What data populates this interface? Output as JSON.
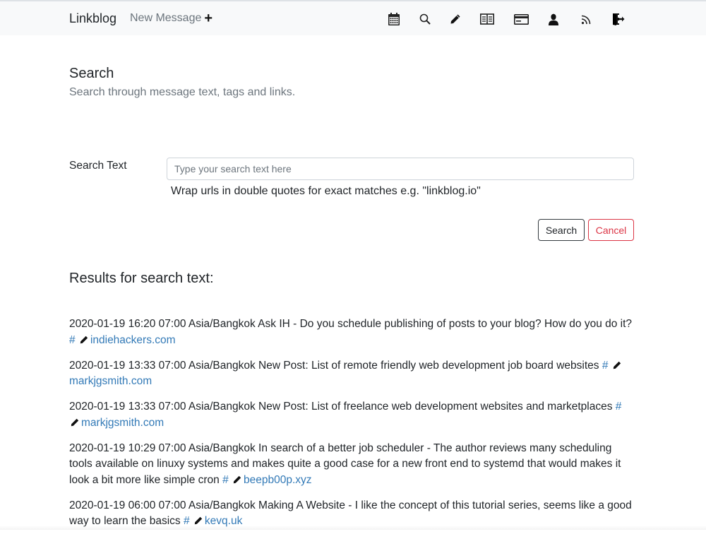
{
  "navbar": {
    "brand": "Linkblog",
    "new_message_label": "New Message",
    "new_message_icon": "plus-icon",
    "icons": [
      {
        "name": "calendar-icon",
        "title": "Calendar"
      },
      {
        "name": "search-icon",
        "title": "Search"
      },
      {
        "name": "pencil-icon",
        "title": "Edit"
      },
      {
        "name": "book-icon",
        "title": "Read"
      },
      {
        "name": "credit-card-icon",
        "title": "Billing"
      },
      {
        "name": "user-icon",
        "title": "Account"
      },
      {
        "name": "rss-icon",
        "title": "RSS"
      },
      {
        "name": "logout-icon",
        "title": "Log out"
      }
    ]
  },
  "page": {
    "title": "Search",
    "subtitle": "Search through message text, tags and links."
  },
  "form": {
    "label": "Search Text",
    "value": "",
    "placeholder": "Type your search text here",
    "help": "Wrap urls in double quotes for exact matches e.g. \"linkblog.io\"",
    "search_button": "Search",
    "cancel_button": "Cancel"
  },
  "results": {
    "title": "Results for search text:",
    "hash": "#",
    "items": [
      {
        "timestamp": "2020-01-19 16:20 07:00 Asia/Bangkok",
        "text": "Ask IH - Do you schedule publishing of posts to your blog? How do you do it?",
        "domain": "indiehackers.com"
      },
      {
        "timestamp": "2020-01-19 13:33 07:00 Asia/Bangkok",
        "text": "New Post: List of remote friendly web development job board websites",
        "domain": "markjgsmith.com"
      },
      {
        "timestamp": "2020-01-19 13:33 07:00 Asia/Bangkok",
        "text": "New Post: List of freelance web development websites and marketplaces",
        "domain": "markjgsmith.com"
      },
      {
        "timestamp": "2020-01-19 10:29 07:00 Asia/Bangkok",
        "text": "In search of a better job scheduler - The author reviews many scheduling tools available on linuxy systems and makes quite a good case for a new front end to systemd that would makes it look a bit more like simple cron",
        "domain": "beepb00p.xyz"
      },
      {
        "timestamp": "2020-01-19 06:00 07:00 Asia/Bangkok",
        "text": "Making A Website - I like the concept of this tutorial series, seems like a good way to learn the basics",
        "domain": "kevq.uk"
      }
    ]
  },
  "colors": {
    "navbar_bg": "#f8f9fa",
    "link": "#337ab7",
    "muted": "#6c757d",
    "danger": "#dc3545"
  }
}
